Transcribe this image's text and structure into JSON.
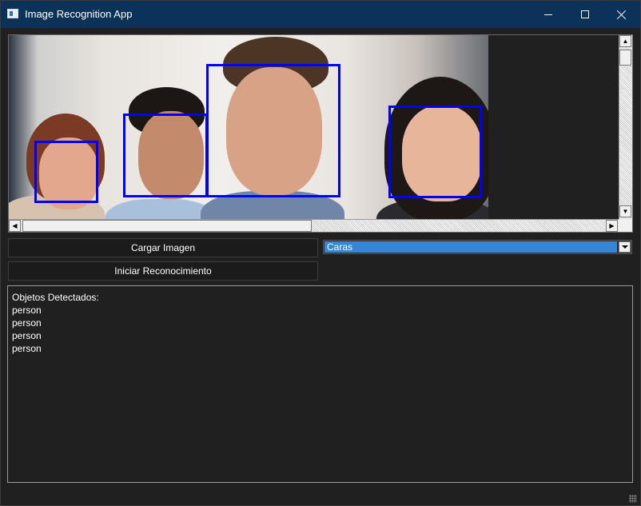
{
  "window": {
    "title": "Image Recognition App"
  },
  "controls": {
    "load_label": "Cargar Imagen",
    "start_label": "Iniciar Reconocimiento",
    "mode_selected": "Caras"
  },
  "results": {
    "lines": [
      "Objetos Detectados:",
      "person",
      "person",
      "person",
      "person"
    ]
  },
  "colors": {
    "title_bar": "#0d3259",
    "window_bg": "#202020",
    "detection_box": "#0000ff",
    "combo_highlight": "#3586d6"
  },
  "icons": [
    "app-icon",
    "minimize-icon",
    "maximize-icon",
    "close-icon",
    "scroll-up-icon",
    "scroll-down-icon",
    "scroll-left-icon",
    "scroll-right-icon",
    "dropdown-arrow-icon",
    "resize-grip-icon"
  ]
}
